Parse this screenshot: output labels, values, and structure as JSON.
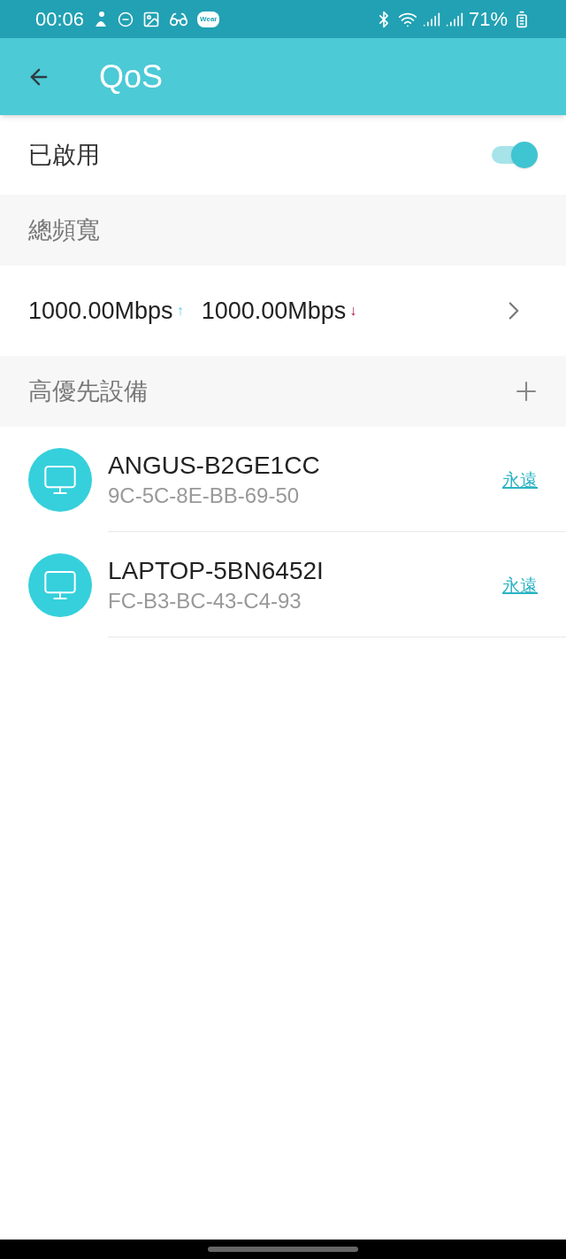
{
  "status_bar": {
    "time": "00:06",
    "badge": "Wear",
    "battery": "71%"
  },
  "app_bar": {
    "title": "QoS"
  },
  "enable_row": {
    "label": "已啟用",
    "on": true
  },
  "bandwidth_section": {
    "title": "總頻寬"
  },
  "bandwidth": {
    "upload": "1000.00Mbps",
    "upload_arrow": "↑",
    "download": "1000.00Mbps",
    "download_arrow": "↓"
  },
  "priority_section": {
    "title": "高優先設備"
  },
  "devices": [
    {
      "name": "ANGUS-B2GE1CC",
      "mac": "9C-5C-8E-BB-69-50",
      "duration": "永遠"
    },
    {
      "name": "LAPTOP-5BN6452I",
      "mac": "FC-B3-BC-43-C4-93",
      "duration": "永遠"
    }
  ]
}
